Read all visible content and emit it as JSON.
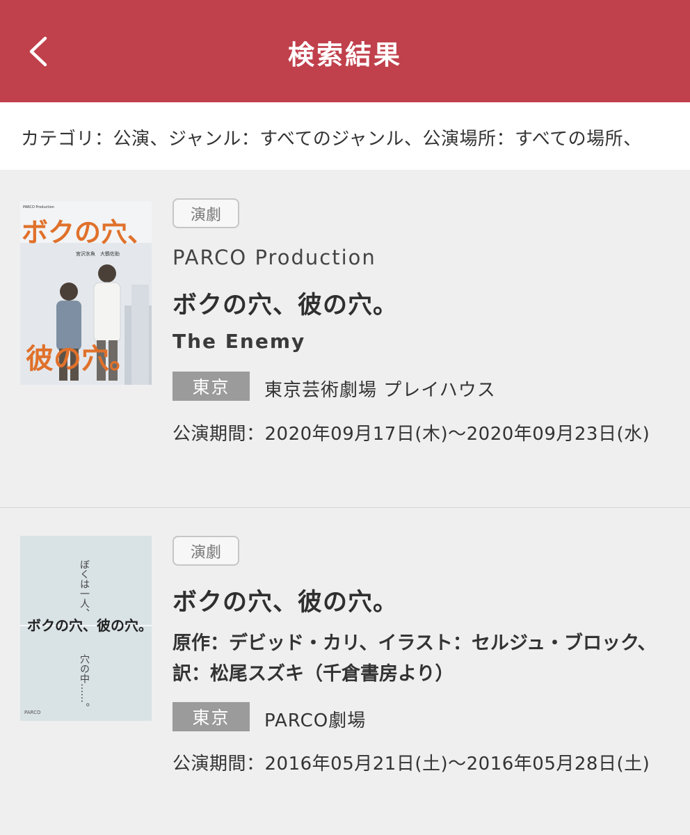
{
  "header": {
    "title": "検索結果",
    "back_icon": "chevron-left-icon",
    "color": "#c0404b"
  },
  "filter": {
    "text": "カテゴリ：公演、ジャンル：すべてのジャンル、公演場所：すべての場所、"
  },
  "results": [
    {
      "poster_alt": "ボクの穴、彼の穴。 poster",
      "poster_text": {
        "top": "ボクの穴、",
        "bottom": "彼の穴。",
        "header": "PARCO Production",
        "cast": "宮沢氷魚　大鶴佐助"
      },
      "genre": "演劇",
      "producer": "PARCO Production",
      "title": "ボクの穴、彼の穴。",
      "subtitle": "The Enemy",
      "area": "東京",
      "venue": "東京芸術劇場 プレイハウス",
      "period": "公演期間：2020年09月17日(木)～2020年09月23日(水)"
    },
    {
      "poster_alt": "ボクの穴、彼の穴。 poster",
      "poster_text": {
        "line1": "ぼくは一人、",
        "title": "ボクの穴、彼の穴。",
        "line2": "穴の中……。",
        "logo": "PARCO"
      },
      "genre": "演劇",
      "title": "ボクの穴、彼の穴。",
      "credits": "原作：デビッド・カリ、イラスト：セルジュ・ブロック、訳：松尾スズキ（千倉書房より）",
      "area": "東京",
      "venue": "PARCO劇場",
      "period": "公演期間：2016年05月21日(土)～2016年05月28日(土)"
    }
  ]
}
